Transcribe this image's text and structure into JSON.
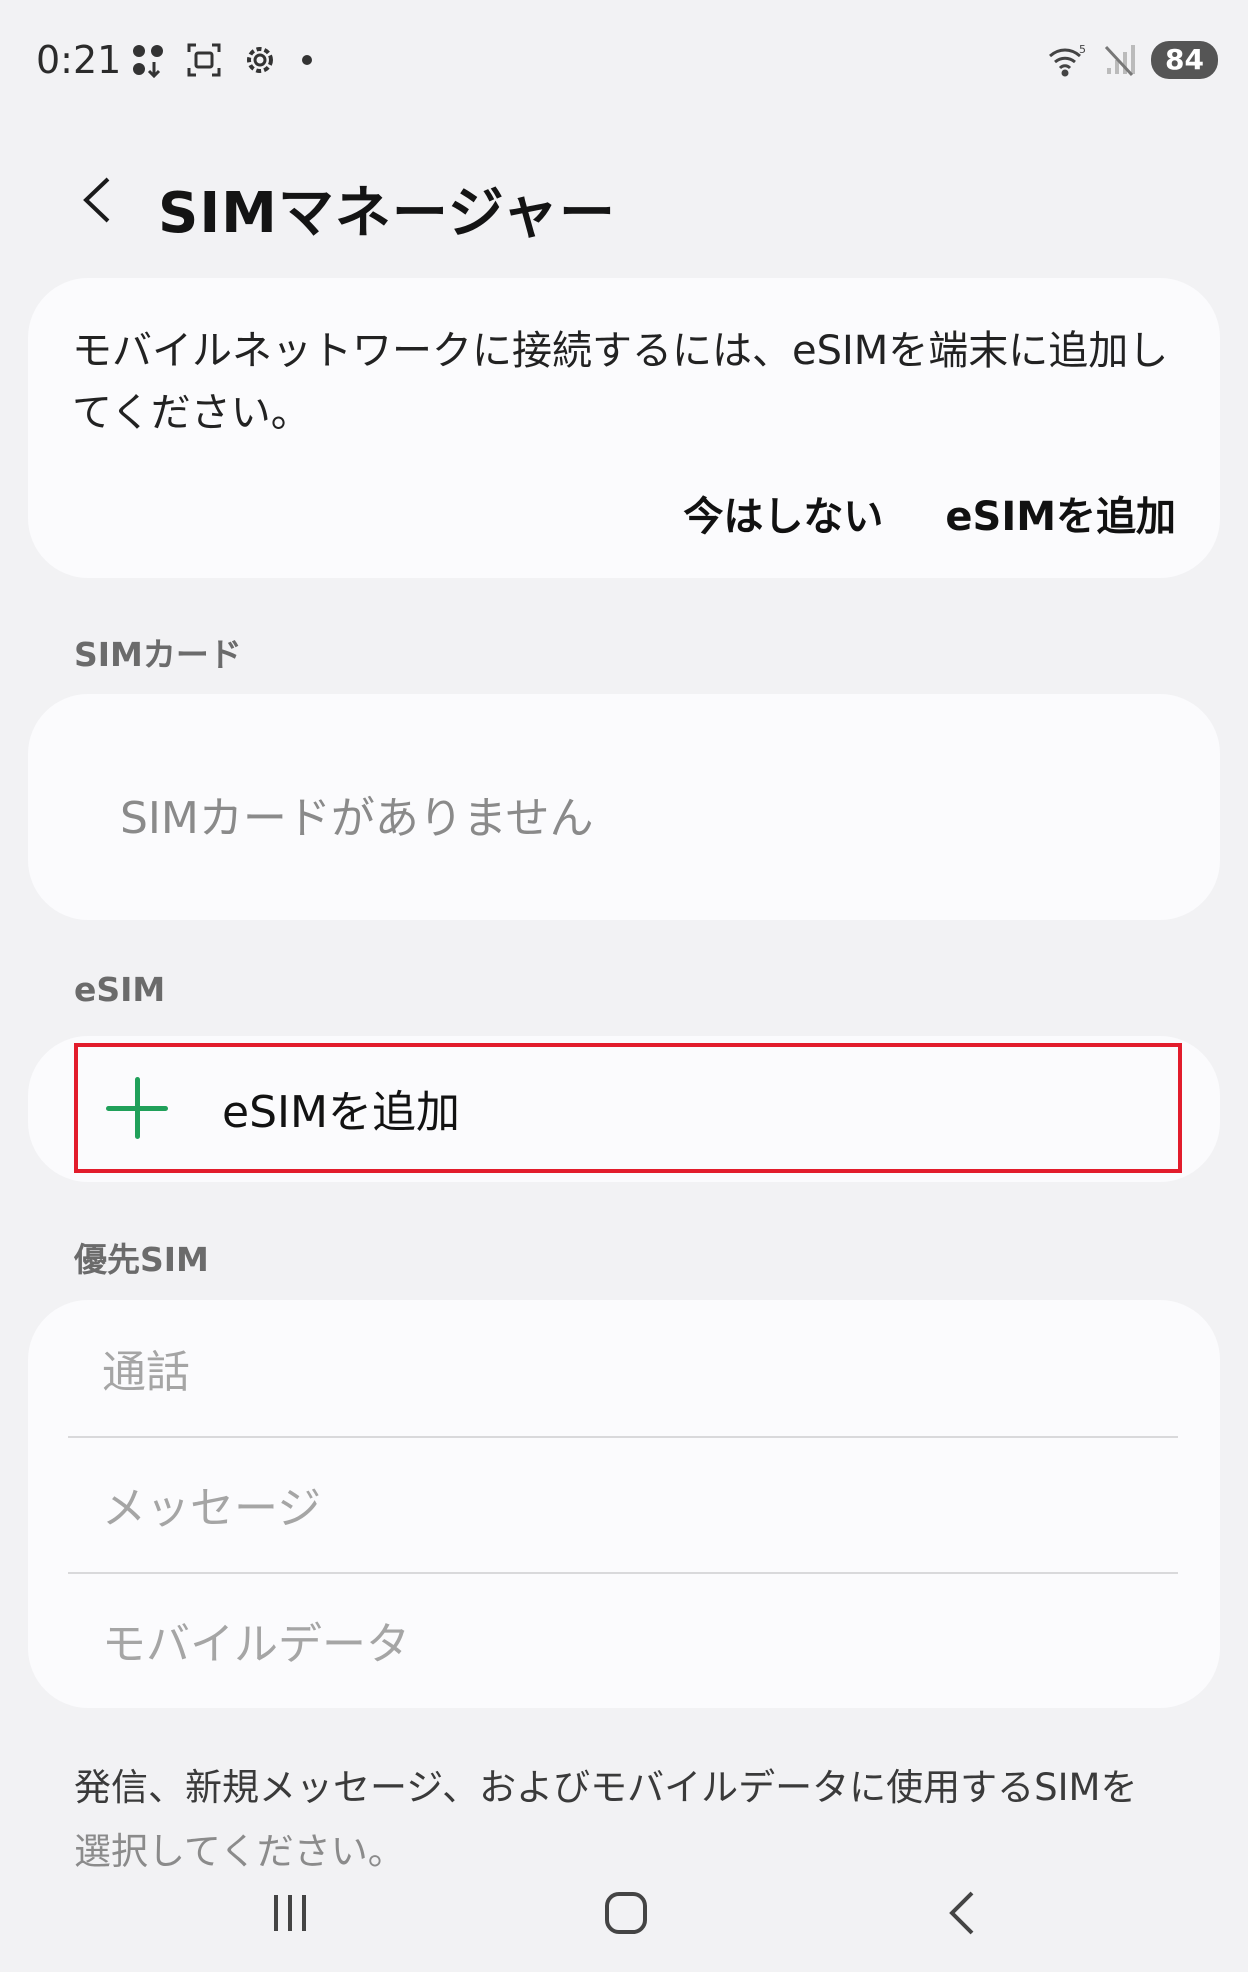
{
  "status_bar": {
    "time": "0:21",
    "battery": "84",
    "icons_left": [
      "notification-dots-icon",
      "screenshot-icon",
      "settings-icon",
      "more-dot-icon"
    ],
    "icons_right": [
      "wifi-5-icon",
      "no-signal-icon",
      "battery-icon"
    ]
  },
  "header": {
    "title": "SIMマネージャー",
    "back_icon": "chevron-left-icon"
  },
  "notice": {
    "text": "モバイルネットワークに接続するには、eSIMを端末に追加してください。",
    "dismiss_label": "今はしない",
    "add_label": "eSIMを追加"
  },
  "sim_cards": {
    "section_label": "SIMカード",
    "empty_text": "SIMカードがありません"
  },
  "esim": {
    "section_label": "eSIM",
    "add_label": "eSIMを追加",
    "icon": "plus-icon",
    "accent_color": "#20a05a",
    "highlight_color": "#e21c2c"
  },
  "preferred_sim": {
    "section_label": "優先SIM",
    "items": [
      {
        "label": "通話"
      },
      {
        "label": "メッセージ"
      },
      {
        "label": "モバイルデータ"
      }
    ]
  },
  "footnote": {
    "line1": "発信、新規メッセージ、およびモバイルデータに使用するSIMを",
    "line2": "選択してください。"
  },
  "nav_bar": {
    "icons": [
      "recent-apps-icon",
      "home-icon",
      "back-icon"
    ]
  }
}
